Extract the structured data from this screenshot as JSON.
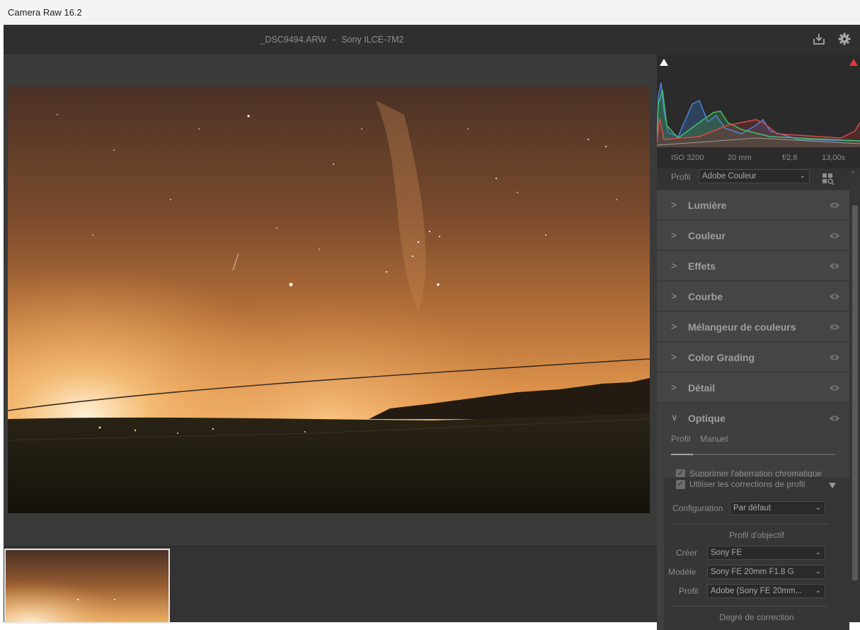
{
  "window": {
    "title": "Camera Raw 16.2"
  },
  "header": {
    "file_name": "_DSC9494.ARW",
    "separator": "-",
    "camera": "Sony ILCE-7M2",
    "save_icon": "save-icon",
    "settings_icon": "gear-icon"
  },
  "exif": {
    "iso": "ISO 3200",
    "focal": "20 mm",
    "aperture": "f/2,8",
    "shutter": "13,00s"
  },
  "profile": {
    "label": "Profil",
    "value": "Adobe Couleur"
  },
  "panels": [
    {
      "label": "Lumière"
    },
    {
      "label": "Couleur"
    },
    {
      "label": "Effets"
    },
    {
      "label": "Courbe"
    },
    {
      "label": "Mélangeur de couleurs"
    },
    {
      "label": "Color Grading"
    },
    {
      "label": "Détail"
    }
  ],
  "optique": {
    "label": "Optique",
    "tabs": [
      "Profil",
      "Manuel"
    ],
    "remove_ca": {
      "label": "Supprimer l'aberration chromatique",
      "checked": true
    },
    "use_profile": {
      "label": "Utiliser les corrections de profil",
      "checked": true
    },
    "configuration": {
      "label": "Configuration",
      "value": "Par défaut"
    },
    "lens_profile_title": "Profil d'objectif",
    "make": {
      "label": "Créer",
      "value": "Sony FE"
    },
    "model": {
      "label": "Modèle",
      "value": "Sony FE 20mm F1.8 G"
    },
    "lens_profile": {
      "label": "Profil",
      "value": "Adobe (Sony FE 20mm..."
    },
    "amount_title": "Degré de correction"
  },
  "colors": {
    "panel_bg": "#3d3d3d",
    "section_bg": "#454545",
    "header_bg": "#2f2f2f",
    "clip_red": "#e03a3a"
  }
}
